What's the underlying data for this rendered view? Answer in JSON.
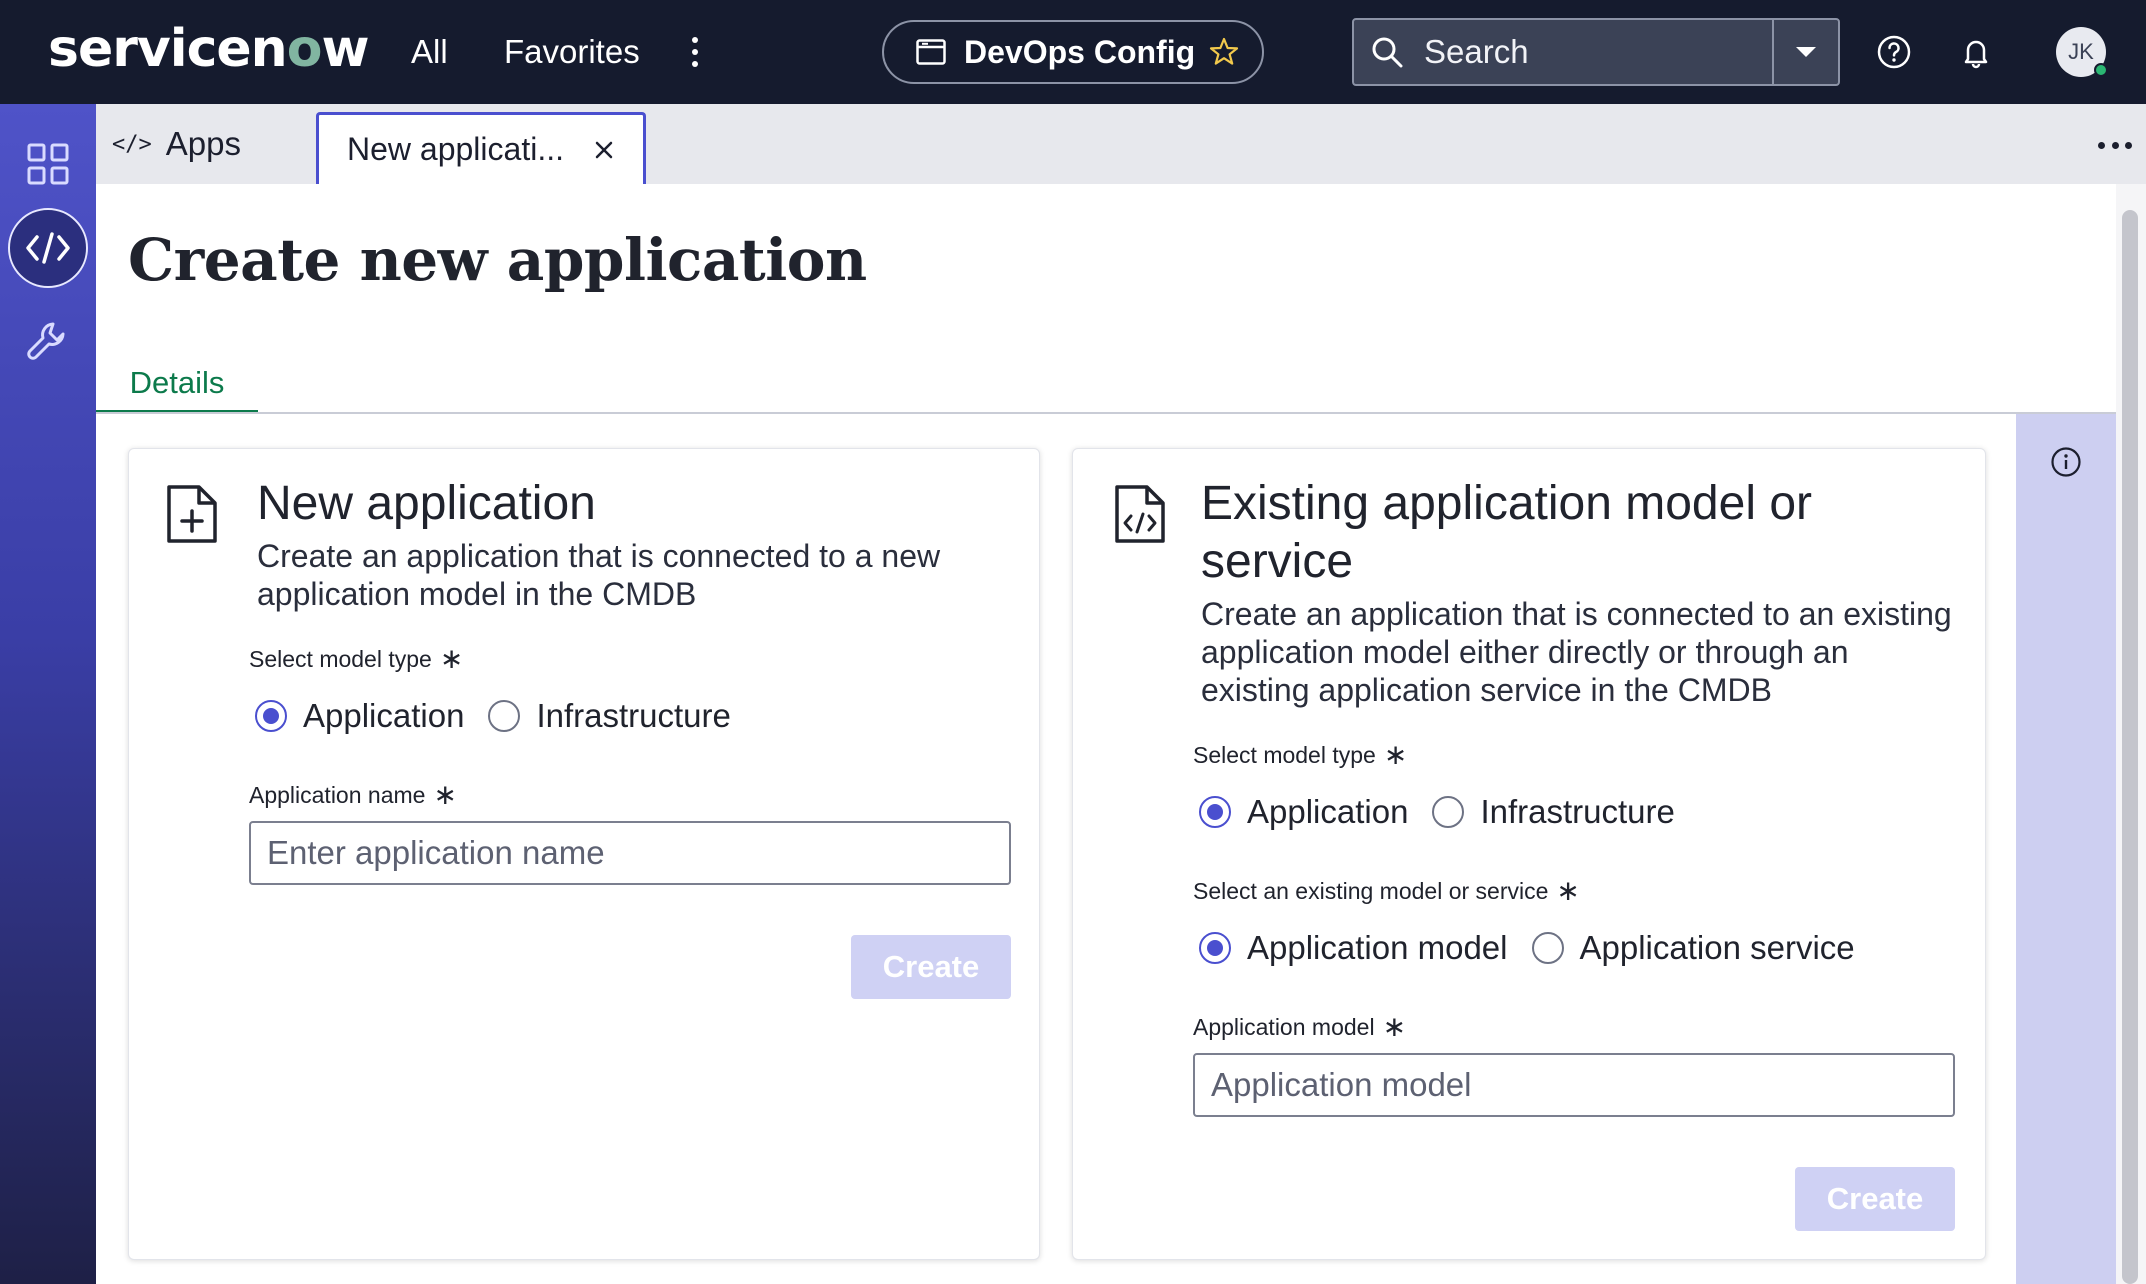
{
  "header": {
    "logo_prefix": "servicen",
    "logo_o": "o",
    "logo_suffix": "w",
    "nav": {
      "all": "All",
      "favorites": "Favorites"
    },
    "scope": "DevOps Config",
    "search_placeholder": "Search",
    "avatar_initials": "JK",
    "icons": [
      "more-vertical-icon",
      "browser-window-icon",
      "star-icon",
      "search-icon",
      "chevron-down-icon",
      "help-icon",
      "bell-icon"
    ]
  },
  "rail": {
    "icons": [
      "grid-icon",
      "code-icon",
      "wrench-icon"
    ]
  },
  "tabs": {
    "apps_icon": "</>",
    "apps_label": "Apps",
    "active_label": "New applicati..."
  },
  "page": {
    "title": "Create new application",
    "tab_details": "Details"
  },
  "new_app": {
    "title": "New application",
    "description": "Create an application that is connected to a new application model in the CMDB",
    "model_type_label": "Select model type",
    "model_type_options": [
      "Application",
      "Infrastructure"
    ],
    "model_type_selected": "Application",
    "name_label": "Application name",
    "name_value": "",
    "name_placeholder": "Enter application name",
    "create_label": "Create"
  },
  "existing_app": {
    "title": "Existing application model or service",
    "description": "Create an application that is connected to an existing application model either directly or through an existing application service in the CMDB",
    "model_type_label": "Select model type",
    "model_type_options": [
      "Application",
      "Infrastructure"
    ],
    "model_type_selected": "Application",
    "existing_label": "Select an existing model or service",
    "existing_options": [
      "Application model",
      "Application service"
    ],
    "existing_selected": "Application model",
    "model_label": "Application model",
    "model_value": "",
    "model_placeholder": "Application model",
    "create_label": "Create"
  },
  "colors": {
    "topbar": "#151b2e",
    "accent": "#4a4fcf",
    "details_tab": "#0c7a4b",
    "disabled_button": "#cfd1f4",
    "side_panel": "#cdcff1"
  }
}
